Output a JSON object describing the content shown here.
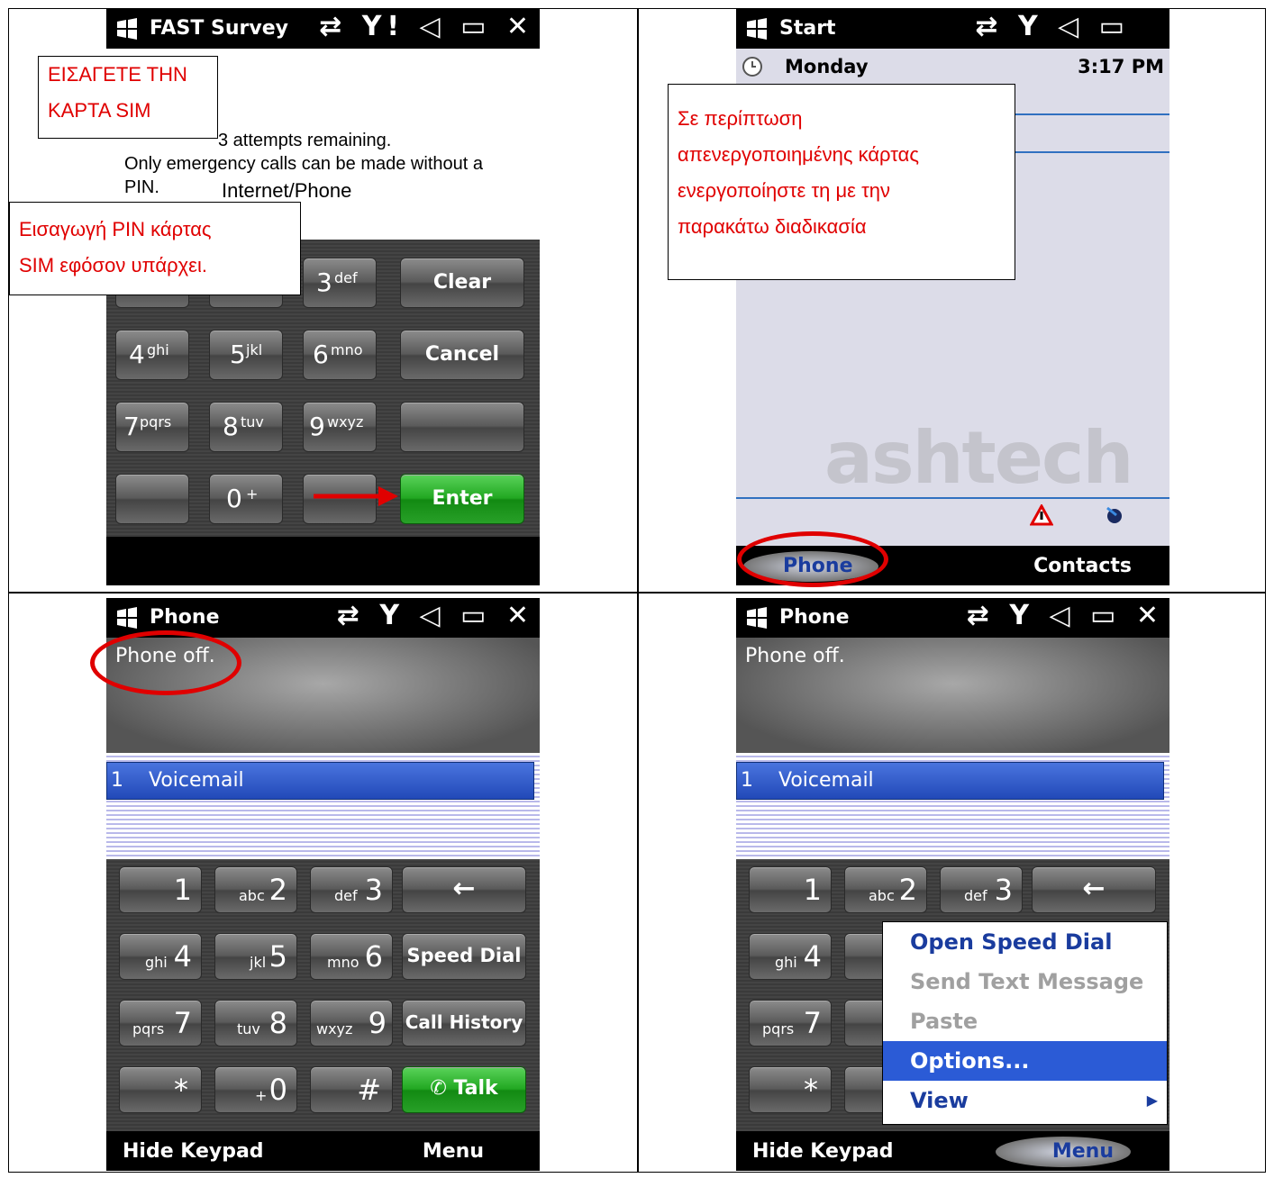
{
  "panel1": {
    "title": "FAST Survey",
    "status_icons": "⇄ Y! ◁ ▭ ✕",
    "msg_attempts": "3 attempts remaining.",
    "msg_line2": "Only emergency calls can be made without a",
    "msg_line3": "PIN.",
    "internet_phone": "Internet/Phone",
    "note_top": [
      "ΕΙΣΑΓΕΤΕ ΤΗΝ",
      "ΚΑΡΤΑ SIM"
    ],
    "note_pin": [
      "Εισαγωγή PIN κάρτας",
      "SIM εφόσον υπάρχει."
    ],
    "keys": {
      "k3": "3",
      "k3l": "def",
      "k4": "4",
      "k4l": "ghi",
      "k5": "5",
      "k5l": "jkl",
      "k6": "6",
      "k6l": "mno",
      "k7": "7",
      "k7l": "pqrs",
      "k8": "8",
      "k8l": "tuv",
      "k9": "9",
      "k9l": "wxyz",
      "k0": "0",
      "k0l": "+",
      "clear": "Clear",
      "cancel": "Cancel",
      "enter": "Enter"
    }
  },
  "panel2": {
    "title": "Start",
    "day": "Monday",
    "time": "3:17 PM",
    "note": [
      "Σε περίπτωση",
      "απενεργοποιημένης κάρτας",
      "ενεργοποίηστε  τη με την",
      "παρακάτω διαδικασία"
    ],
    "logo": "ashtech",
    "soft_left": "Phone",
    "soft_right": "Contacts"
  },
  "panel3": {
    "title": "Phone",
    "status": "Phone off.",
    "voicemail_num": "1",
    "voicemail": "Voicemail",
    "keys": {
      "k1": "1",
      "k2": "2",
      "k2l": "abc",
      "k3": "3",
      "k3l": "def",
      "k4": "4",
      "k4l": "ghi",
      "k5": "5",
      "k5l": "jkl",
      "k6": "6",
      "k6l": "mno",
      "k7": "7",
      "k7l": "pqrs",
      "k8": "8",
      "k8l": "tuv",
      "k9": "9",
      "k9l": "wxyz",
      "star": "*",
      "k0": "0",
      "k0l": "+",
      "hash": "#",
      "back": "←",
      "speed": "Speed Dial",
      "history": "Call History",
      "talk": "Talk"
    },
    "soft_left": "Hide Keypad",
    "soft_right": "Menu"
  },
  "panel4": {
    "title": "Phone",
    "status": "Phone off.",
    "voicemail_num": "1",
    "voicemail": "Voicemail",
    "menu": {
      "open_speed": "Open Speed Dial",
      "send_text": "Send Text Message",
      "paste": "Paste",
      "options": "Options...",
      "view": "View"
    },
    "soft_left": "Hide Keypad",
    "soft_right": "Menu"
  }
}
